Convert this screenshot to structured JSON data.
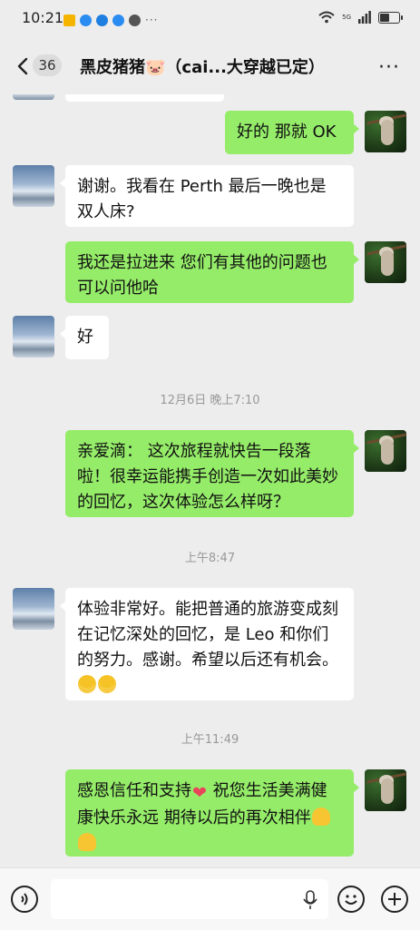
{
  "status": {
    "time": "10:21",
    "battery_level": 0.55,
    "network_badge": "5G"
  },
  "header": {
    "unread_count": "36",
    "title": "黑皮猪猪🐷（cai...大穿越已定）"
  },
  "messages": [
    {
      "side": "out",
      "text": "好的 那就 OK"
    },
    {
      "side": "in",
      "text": "谢谢。我看在 Perth 最后一晚也是双人床?"
    },
    {
      "side": "out",
      "text": "我还是拉进来 您们有其他的问题也可以问他哈"
    },
    {
      "side": "in",
      "text": "好"
    },
    {
      "timestamp": "12月6日 晚上7:10"
    },
    {
      "side": "out",
      "text": "亲爱滴： 这次旅程就快告一段落啦！很幸运能携手创造一次如此美妙的回忆，这次体验怎么样呀？"
    },
    {
      "timestamp": "上午8:47"
    },
    {
      "side": "in",
      "text": "体验非常好。能把普通的旅游变成刻在记忆深处的回忆，是 Leo 和你们的努力。感谢。希望以后还有机会。"
    },
    {
      "timestamp": "上午11:49"
    },
    {
      "side": "out",
      "text_a": "感恩信任和支持",
      "text_b": " 祝您生活美满健康快乐永远 期待以后的再次相伴"
    }
  ],
  "icons": {
    "back": "chevron-left-icon",
    "more": "more-dots-icon",
    "voice": "voice-icon",
    "mic": "mic-icon",
    "emoji": "emoji-icon",
    "plus": "plus-icon"
  },
  "colors": {
    "outgoing_bubble": "#95ec69",
    "incoming_bubble": "#ffffff",
    "background": "#ededed"
  }
}
